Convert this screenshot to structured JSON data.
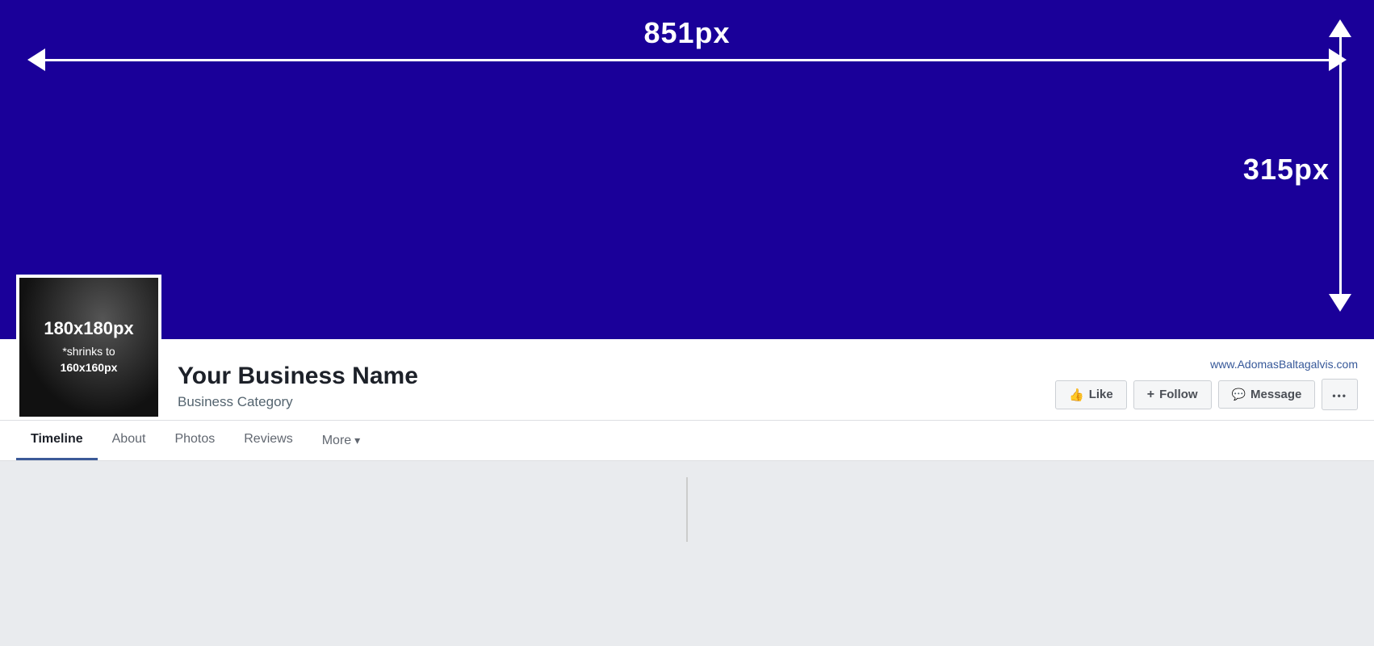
{
  "cover": {
    "background_color": "#1a0099",
    "width_label": "851px",
    "height_label": "315px"
  },
  "profile": {
    "picture": {
      "size_label": "180x180px",
      "shrink_text": "*shrinks to",
      "shrink_size": "160x160px"
    },
    "business_name": "Your Business Name",
    "business_category": "Business Category",
    "website": "www.AdomasBaltagalvis.com"
  },
  "buttons": {
    "like": "Like",
    "follow": "Follow",
    "message": "Message",
    "more_dots": "···"
  },
  "nav": {
    "tabs": [
      {
        "label": "Timeline",
        "active": true
      },
      {
        "label": "About",
        "active": false
      },
      {
        "label": "Photos",
        "active": false
      },
      {
        "label": "Reviews",
        "active": false
      },
      {
        "label": "More",
        "active": false
      }
    ]
  }
}
